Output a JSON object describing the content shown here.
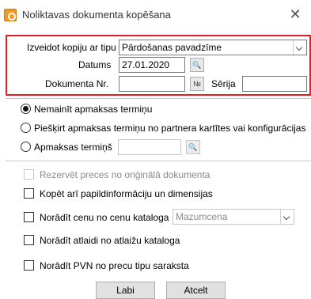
{
  "window": {
    "title": "Noliktavas dokumenta kopēšana",
    "icon": "app-gear-icon",
    "close_symbol": "✕"
  },
  "copy_section": {
    "type_label": "Izveidot kopiju ar tipu",
    "type_value": "Pārdošanas pavadzīme",
    "date_label": "Datums",
    "date_value": "27.01.2020",
    "date_button": "🔍",
    "doc_nr_label": "Dokumenta Nr.",
    "doc_nr_value": "",
    "doc_nr_button": "№",
    "series_label": "Sērija",
    "series_value": ""
  },
  "payment_options": [
    {
      "label": "Nemainīt apmaksas termiņu",
      "checked": true
    },
    {
      "label": "Piešķirt apmaksas termiņu no partnera kartītes vai konfigurācijas",
      "checked": false
    },
    {
      "label": "Apmaksas termiņš",
      "checked": false
    }
  ],
  "payment_term_value": "",
  "payment_term_button": "🔍",
  "checkboxes": {
    "reserve": "Rezervēt preces no oriģinālā dokumenta",
    "copy_extra": "Kopēt arī papildinformāciju un dimensijas",
    "price_catalog": "Norādīt cenu no cenu kataloga",
    "price_catalog_value": "Mazumcena",
    "discount": "Norādīt atlaidi no atlaižu kataloga",
    "vat": "Norādīt PVN no precu tipu saraksta"
  },
  "buttons": {
    "ok": "Labi",
    "cancel": "Atcelt"
  },
  "colors": {
    "highlight_border": "#e02020",
    "app_icon": "#f29a20"
  }
}
